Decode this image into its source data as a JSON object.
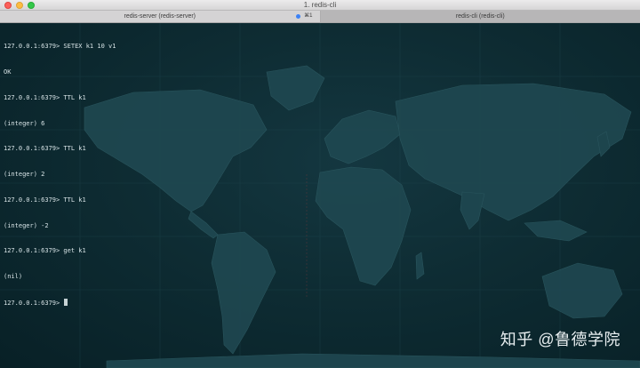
{
  "window": {
    "title": "1. redis-cli",
    "controls": [
      "close",
      "minimize",
      "zoom"
    ]
  },
  "tabs": [
    {
      "label": "redis-server (redis-server)",
      "shortcut": "⌘1",
      "state": "inactive",
      "has_activity_dot": true
    },
    {
      "label": "redis-cli (redis-cli)",
      "state": "active"
    }
  ],
  "terminal": {
    "lines": [
      "127.0.0.1:6379> SETEX k1 10 v1",
      "OK",
      "127.0.0.1:6379> TTL k1",
      "(integer) 6",
      "127.0.0.1:6379> TTL k1",
      "(integer) 2",
      "127.0.0.1:6379> TTL k1",
      "(integer) -2",
      "127.0.0.1:6379> get k1",
      "(nil)"
    ],
    "prompt": "127.0.0.1:6379> ",
    "background": "world map"
  },
  "watermark": "知乎 @鲁德学院",
  "colors": {
    "terminal_bg": "#0e2c33",
    "terminal_text": "#d7e3e6",
    "activity_dot": "#3b82f6"
  }
}
